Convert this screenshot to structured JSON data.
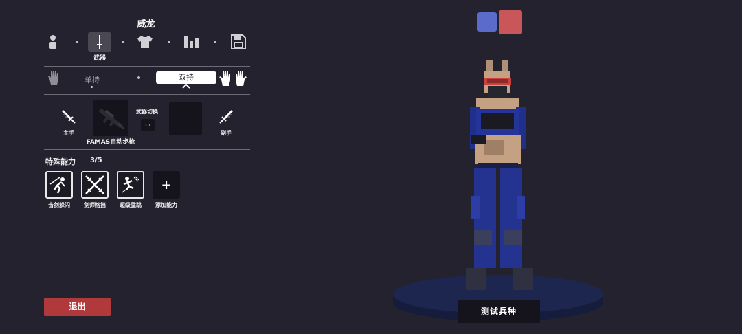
{
  "unit": {
    "name": "威龙"
  },
  "tabs": [
    {
      "id": "body",
      "icon": "person-icon",
      "label": ""
    },
    {
      "id": "weapon",
      "icon": "sword-icon",
      "label": "武器",
      "active": true
    },
    {
      "id": "clothing",
      "icon": "shirt-icon",
      "label": ""
    },
    {
      "id": "stats",
      "icon": "bar-chart-icon",
      "label": ""
    },
    {
      "id": "save",
      "icon": "save-icon",
      "label": ""
    }
  ],
  "grip": {
    "single_label": "单持",
    "dual_label": "双持",
    "selected": "dual"
  },
  "weapons": {
    "main_hand_label": "主手",
    "off_hand_label": "副手",
    "main_weapon_name": "FAMAS自动步枪",
    "switch_label": "武器切换",
    "switch_icon": "swap-arrows-icon"
  },
  "abilities": {
    "heading": "特殊能力",
    "count": "3/5",
    "items": [
      {
        "label": "击剑躲闪",
        "icon": "dodge-icon"
      },
      {
        "label": "剑师格挡",
        "icon": "crossed-swords-icon"
      },
      {
        "label": "超级猛跳",
        "icon": "super-jump-icon"
      }
    ],
    "add_label": "添加能力",
    "add_symbol": "+"
  },
  "exit_label": "退出",
  "test_label": "测试兵种",
  "team_colors": {
    "blue": "#5a6bcb",
    "red": "#c95659"
  },
  "accent": {
    "exit": "#b0393c",
    "background": "#24222e"
  }
}
